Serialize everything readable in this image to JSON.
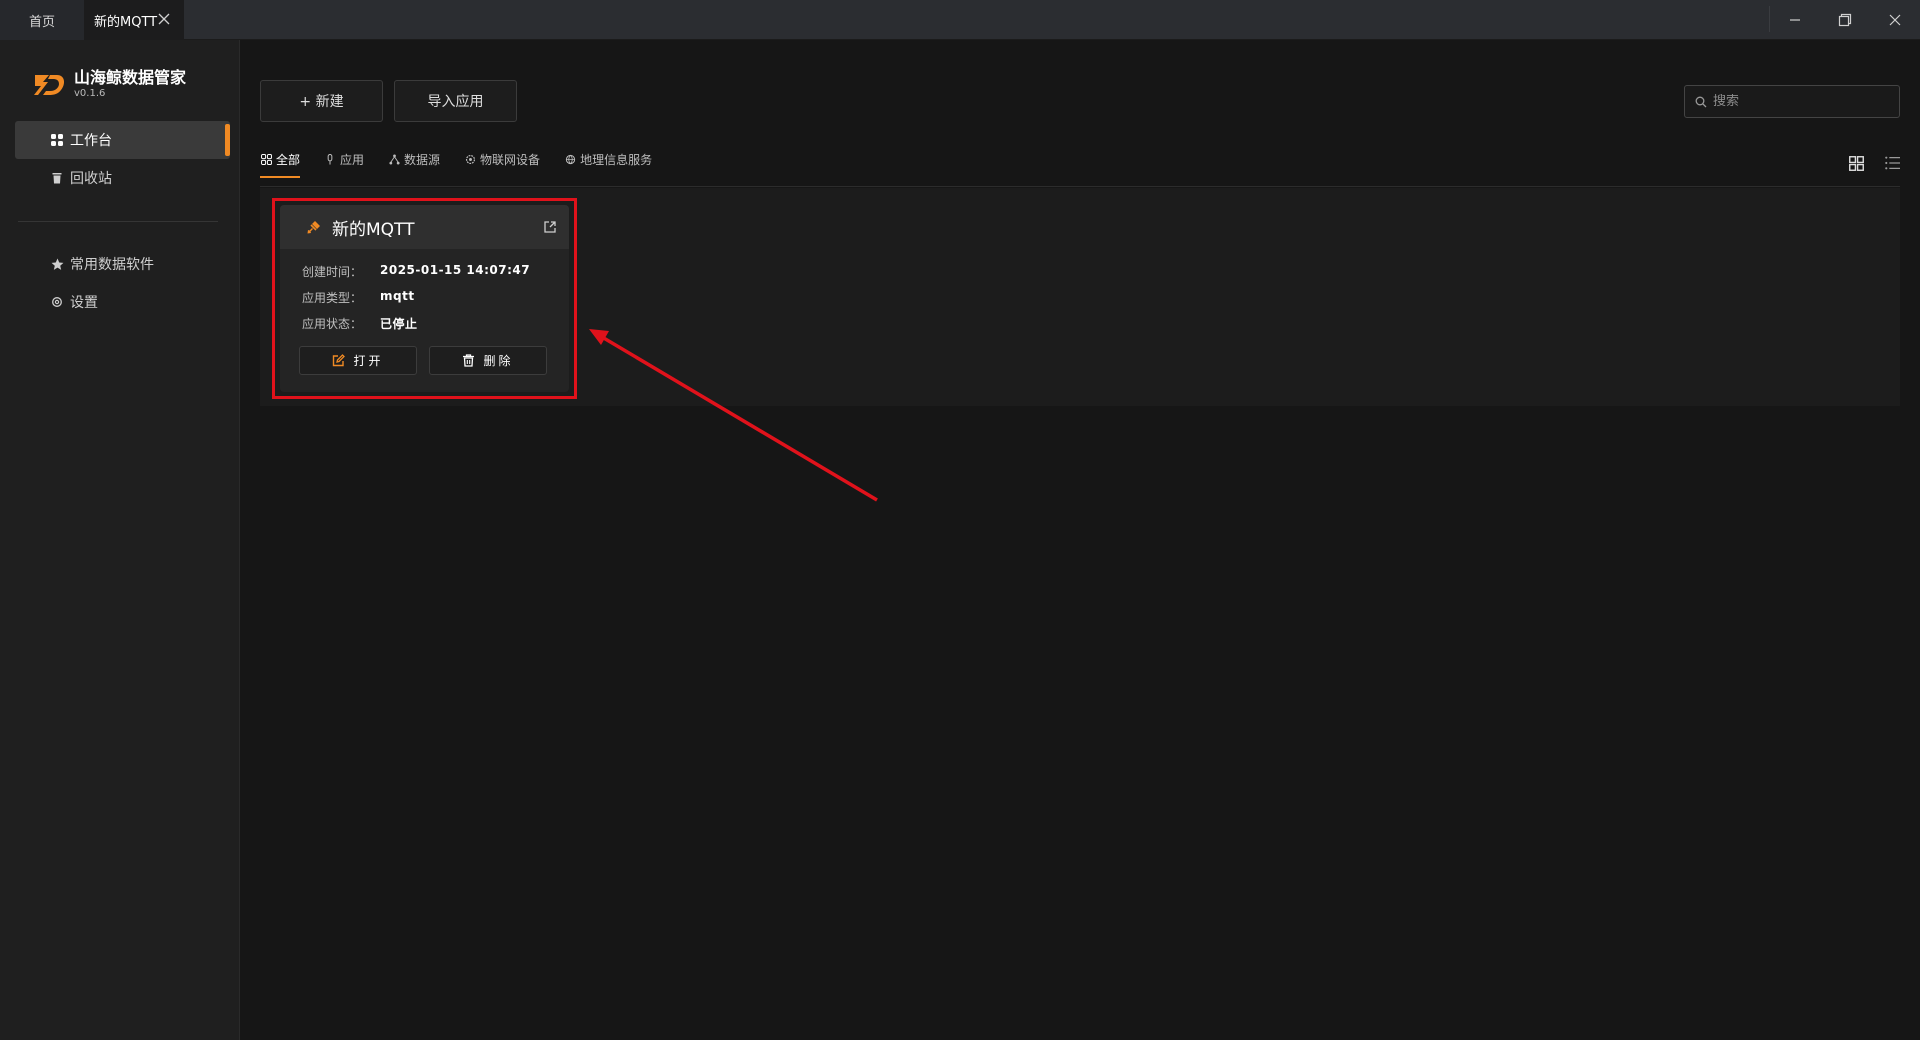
{
  "titlebar": {
    "tabs": [
      {
        "label": "首页"
      },
      {
        "label": "新的MQTT"
      }
    ]
  },
  "brand": {
    "name": "山海鲸数据管家",
    "version": "v0.1.6"
  },
  "sidebar": {
    "items": [
      {
        "label": "工作台",
        "icon": "grid-icon",
        "active": true
      },
      {
        "label": "回收站",
        "icon": "trash-icon"
      },
      {
        "label": "常用数据软件",
        "icon": "star-icon"
      },
      {
        "label": "设置",
        "icon": "gear-icon"
      }
    ]
  },
  "toolbar": {
    "new_label": "+ 新建",
    "import_label": "导入应用"
  },
  "search": {
    "placeholder": "搜索"
  },
  "filters": [
    {
      "label": "全部",
      "icon": "grid-icon",
      "active": true
    },
    {
      "label": "应用",
      "icon": "mic-icon"
    },
    {
      "label": "数据源",
      "icon": "network-icon"
    },
    {
      "label": "物联网设备",
      "icon": "gear-icon"
    },
    {
      "label": "地理信息服务",
      "icon": "globe-icon"
    }
  ],
  "card": {
    "title": "新的MQTT",
    "rows": [
      {
        "key": "创建时间：",
        "value": "2025-01-15 14:07:47"
      },
      {
        "key": "应用类型：",
        "value": "mqtt"
      },
      {
        "key": "应用状态：",
        "value": "已停止"
      }
    ],
    "open_label": "打开",
    "delete_label": "删除"
  },
  "colors": {
    "accent": "#f08a24",
    "annotation": "#e0121b"
  }
}
